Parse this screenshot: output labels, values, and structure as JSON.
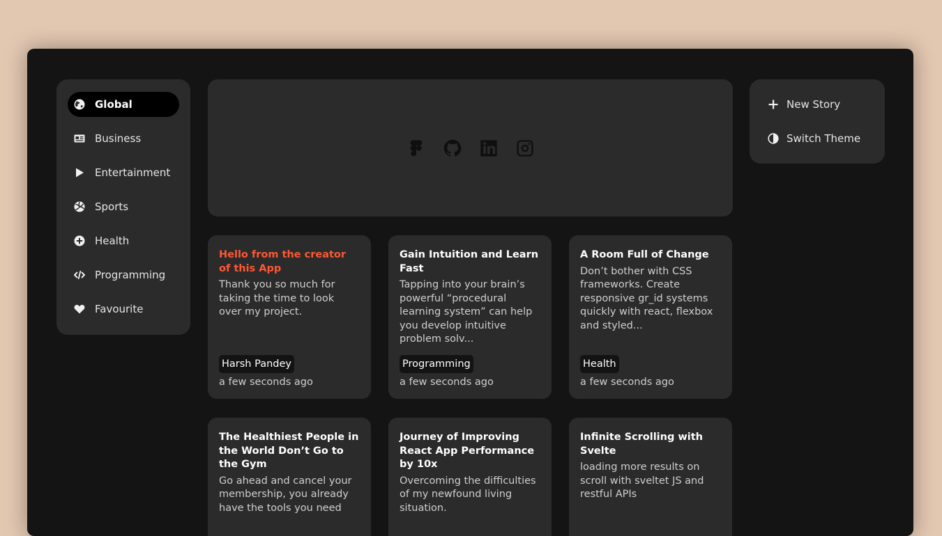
{
  "sidebar": {
    "items": [
      {
        "label": "Global",
        "icon": "globe-icon",
        "active": true
      },
      {
        "label": "Business",
        "icon": "newspaper-icon",
        "active": false
      },
      {
        "label": "Entertainment",
        "icon": "play-icon",
        "active": false
      },
      {
        "label": "Sports",
        "icon": "volleyball-icon",
        "active": false
      },
      {
        "label": "Health",
        "icon": "plus-circle-icon",
        "active": false
      },
      {
        "label": "Programming",
        "icon": "code-icon",
        "active": false
      },
      {
        "label": "Favourite",
        "icon": "heart-icon",
        "active": false
      }
    ]
  },
  "banner": {
    "socials": [
      "figma-icon",
      "github-icon",
      "linkedin-icon",
      "instagram-icon"
    ]
  },
  "actions": {
    "new_story": "New Story",
    "switch_theme": "Switch Theme"
  },
  "colors": {
    "accent": "#ff5733",
    "background": "#e2c7b1",
    "app": "#141414",
    "panel": "#2b2b2b"
  },
  "cards": [
    {
      "title": "Hello from the creator of this App",
      "description": "Thank you so much for taking the time to look over my project.",
      "tag": "Harsh Pandey",
      "time": "a few seconds ago",
      "accent": true
    },
    {
      "title": "Gain Intuition and Learn Fast",
      "description": "Tapping into your brain’s powerful “procedural learning system” can help you develop intuitive problem solv...",
      "tag": "Programming",
      "time": "a few seconds ago",
      "accent": false
    },
    {
      "title": "A Room Full of Change",
      "description": "Don’t bother with CSS frameworks. Create responsive gr_id systems quickly with react, flexbox and styled...",
      "tag": "Health",
      "time": "a few seconds ago",
      "accent": false
    },
    {
      "title": "The Healthiest People in the World Don’t Go to the Gym",
      "description": "Go ahead and cancel your membership, you already have the tools you need",
      "tag": "",
      "time": "",
      "accent": false
    },
    {
      "title": "Journey of Improving React App Performance by 10x",
      "description": "Overcoming the difficulties of my newfound living situation.",
      "tag": "",
      "time": "",
      "accent": false
    },
    {
      "title": "Infinite Scrolling with Svelte",
      "description": "loading more results on scroll with sveltet JS and restful APIs",
      "tag": "",
      "time": "",
      "accent": false
    }
  ]
}
